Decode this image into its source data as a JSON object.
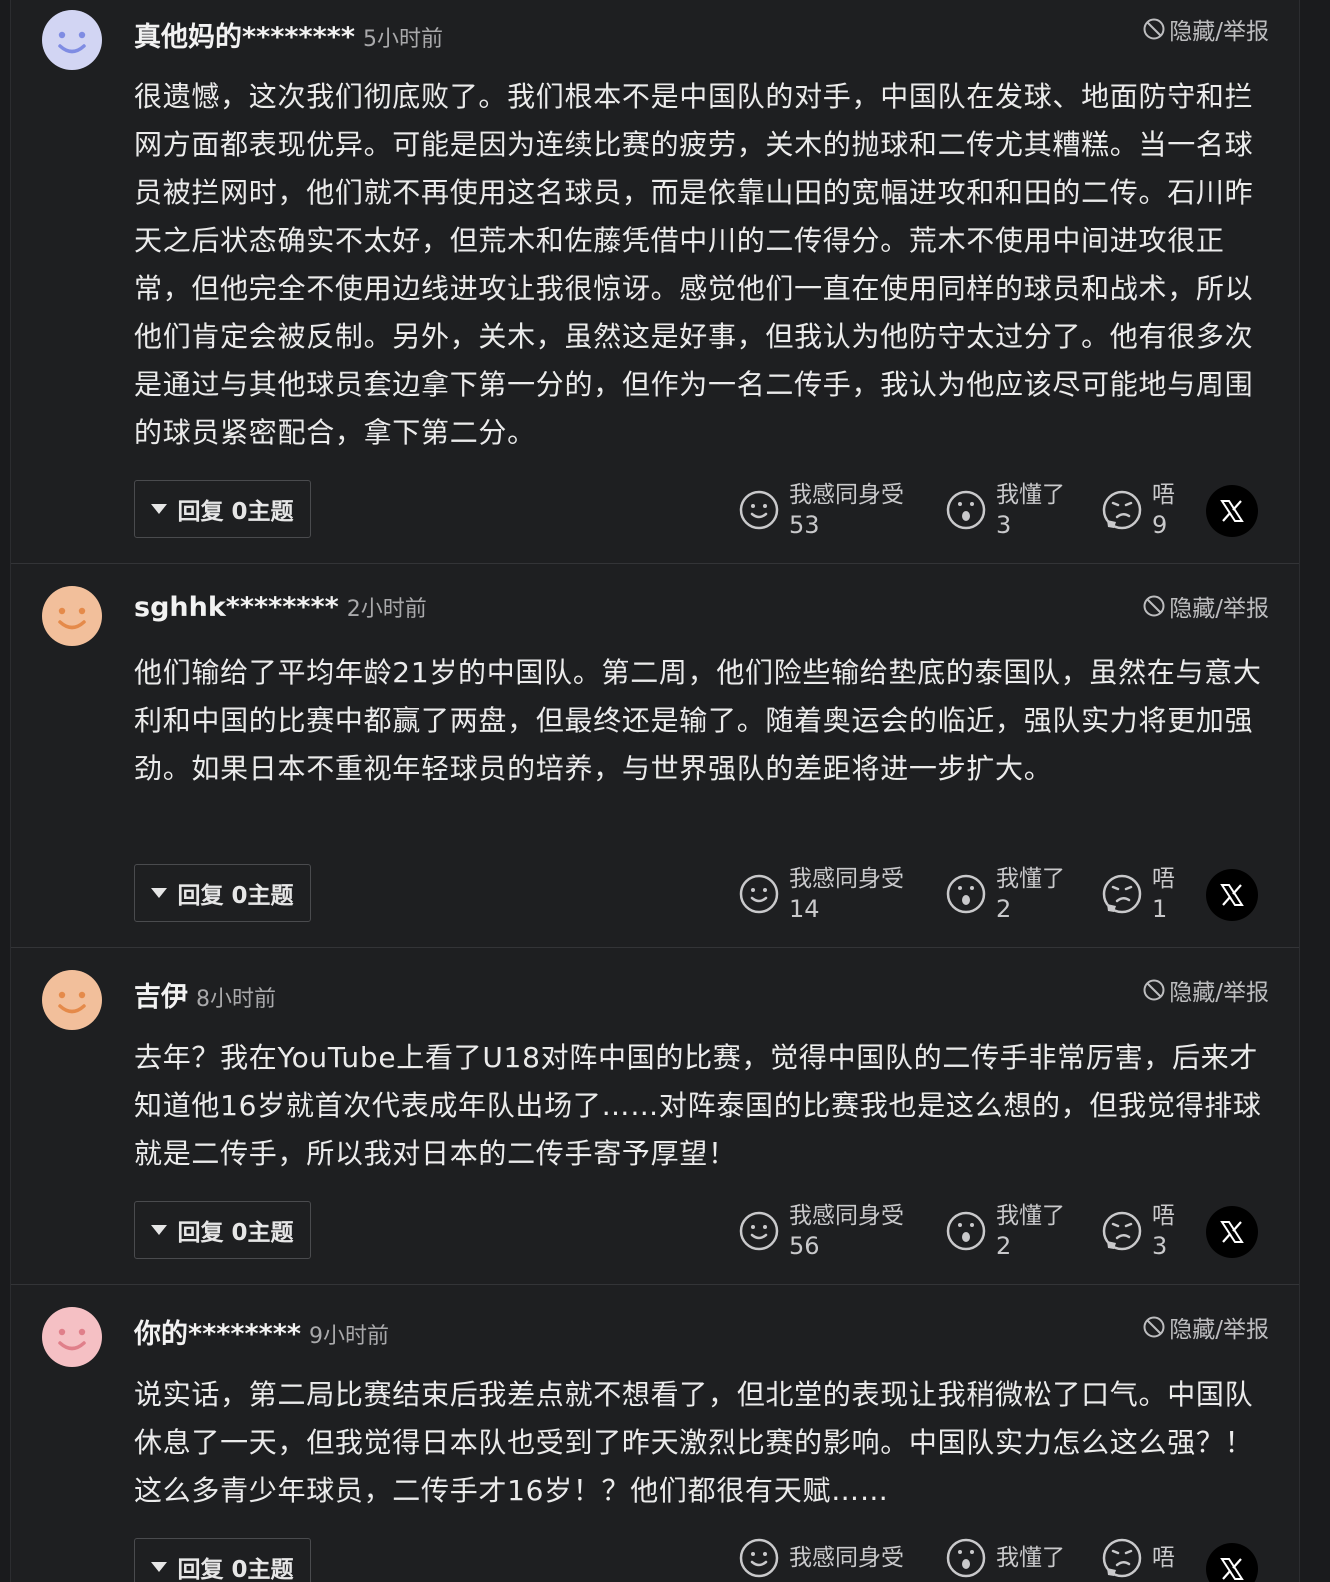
{
  "comments": [
    {
      "user": "真他妈的********",
      "time": "5小时前",
      "avatar_color": "#d2d5f3",
      "hide_report": "隐藏/举报",
      "text": "很遗憾，这次我们彻底败了。我们根本不是中国队的对手，中国队在发球、地面防守和拦网方面都表现优异。可能是因为连续比赛的疲劳，关木的抛球和二传尤其糟糕。当一名球员被拦网时，他们就不再使用这名球员，而是依靠山田的宽幅进攻和和田的二传。石川昨天之后状态确实不太好，但荒木和佐藤凭借中川的二传得分。荒木不使用中间进攻很正常，但他完全不使用边线进攻让我很惊讶。感觉他们一直在使用同样的球员和战术，所以他们肯定会被反制。另外，关木，虽然这是好事，但我认为他防守太过分了。他有很多次是通过与其他球员套边拿下第一分的，但作为一名二传手，我认为他应该尽可能地与周围的球员紧密配合，拿下第二分。",
      "reply": "回复 0主题",
      "reactions": [
        {
          "label": "我感同身受",
          "count": "53",
          "icon": "smile-icon"
        },
        {
          "label": "我懂了",
          "count": "3",
          "icon": "surprised-icon"
        },
        {
          "label": "唔",
          "count": "9",
          "icon": "thinking-icon"
        }
      ]
    },
    {
      "user": "sghhk********",
      "time": "2小时前",
      "avatar_color": "#f2bf9b",
      "hide_report": "隐藏/举报",
      "text": "他们输给了平均年龄21岁的中国队。第二周，他们险些输给垫底的泰国队，虽然在与意大利和中国的比赛中都赢了两盘，但最终还是输了。随着奥运会的临近，强队实力将更加强劲。如果日本不重视年轻球员的培养，与世界强队的差距将进一步扩大。",
      "reply": "回复 0主题",
      "reactions": [
        {
          "label": "我感同身受",
          "count": "14",
          "icon": "smile-icon"
        },
        {
          "label": "我懂了",
          "count": "2",
          "icon": "surprised-icon"
        },
        {
          "label": "唔",
          "count": "1",
          "icon": "thinking-icon"
        }
      ]
    },
    {
      "user": "吉伊",
      "time": "8小时前",
      "avatar_color": "#f2bf9b",
      "hide_report": "隐藏/举报",
      "text": "去年？我在YouTube上看了U18对阵中国的比赛，觉得中国队的二传手非常厉害，后来才知道他16岁就首次代表成年队出场了……对阵泰国的比赛我也是这么想的，但我觉得排球就是二传手，所以我对日本的二传手寄予厚望！",
      "reply": "回复 0主题",
      "reactions": [
        {
          "label": "我感同身受",
          "count": "56",
          "icon": "smile-icon"
        },
        {
          "label": "我懂了",
          "count": "2",
          "icon": "surprised-icon"
        },
        {
          "label": "唔",
          "count": "3",
          "icon": "thinking-icon"
        }
      ]
    },
    {
      "user": "你的********",
      "time": "9小时前",
      "avatar_color": "#f5c0c4",
      "hide_report": "隐藏/举报",
      "text": "说实话，第二局比赛结束后我差点就不想看了，但北堂的表现让我稍微松了口气。中国队休息了一天，但我觉得日本队也受到了昨天激烈比赛的影响。中国队实力怎么这么强？！这么多青少年球员，二传手才16岁！？他们都很有天赋……",
      "reply": "回复 0主题",
      "reactions": [
        {
          "label": "我感同身受",
          "count": "",
          "icon": "smile-icon"
        },
        {
          "label": "我懂了",
          "count": "",
          "icon": "surprised-icon"
        },
        {
          "label": "唔",
          "count": "",
          "icon": "thinking-icon"
        }
      ]
    }
  ]
}
